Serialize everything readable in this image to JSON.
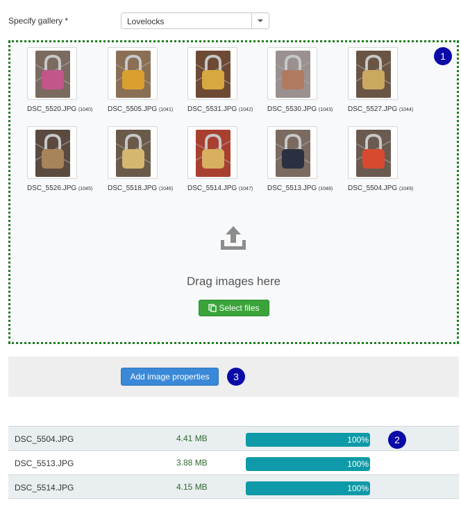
{
  "form": {
    "gallery_label": "Specify gallery *",
    "gallery_value": "Lovelocks"
  },
  "dropzone": {
    "thumbnails": [
      {
        "name": "DSC_5520.JPG",
        "id": "(1040)",
        "lock_color": "#c2558a",
        "bg": "#7a6a60"
      },
      {
        "name": "DSC_5505.JPG",
        "id": "(1041)",
        "lock_color": "#d9a030",
        "bg": "#8a6f55"
      },
      {
        "name": "DSC_5531.JPG",
        "id": "(1042)",
        "lock_color": "#d8a840",
        "bg": "#6e4a35"
      },
      {
        "name": "DSC_5530.JPG",
        "id": "(1043)",
        "lock_color": "#b07a60",
        "bg": "#9a9090"
      },
      {
        "name": "DSC_5527.JPG",
        "id": "(1044)",
        "lock_color": "#c9a860",
        "bg": "#6a5545"
      },
      {
        "name": "DSC_5526.JPG",
        "id": "(1045)",
        "lock_color": "#a8845a",
        "bg": "#5a4a40"
      },
      {
        "name": "DSC_5518.JPG",
        "id": "(1046)",
        "lock_color": "#d4b870",
        "bg": "#6a5a4a"
      },
      {
        "name": "DSC_5514.JPG",
        "id": "(1047)",
        "lock_color": "#d8b060",
        "bg": "#a84030"
      },
      {
        "name": "DSC_5513.JPG",
        "id": "(1048)",
        "lock_color": "#2a3040",
        "bg": "#7a6a60"
      },
      {
        "name": "DSC_5504.JPG",
        "id": "(1049)",
        "lock_color": "#d84a30",
        "bg": "#6a5a50"
      }
    ],
    "drag_text": "Drag images here",
    "select_files_label": "Select files",
    "badge": "1"
  },
  "toolbar": {
    "add_properties_label": "Add image properties",
    "badge": "3"
  },
  "uploads": {
    "badge": "2",
    "files": [
      {
        "name": "DSC_5504.JPG",
        "size": "4.41 MB",
        "progress_label": "100%",
        "progress": 1.0
      },
      {
        "name": "DSC_5513.JPG",
        "size": "3.88 MB",
        "progress_label": "100%",
        "progress": 1.0
      },
      {
        "name": "DSC_5514.JPG",
        "size": "4.15 MB",
        "progress_label": "100%",
        "progress": 1.0
      }
    ]
  },
  "colors": {
    "dropzone_border": "#1e7d1e",
    "select_files_button": "#3aa43a",
    "add_properties_button": "#3a88d8",
    "progress_fill": "#0e9aa8",
    "badge": "#0a0aa8"
  }
}
